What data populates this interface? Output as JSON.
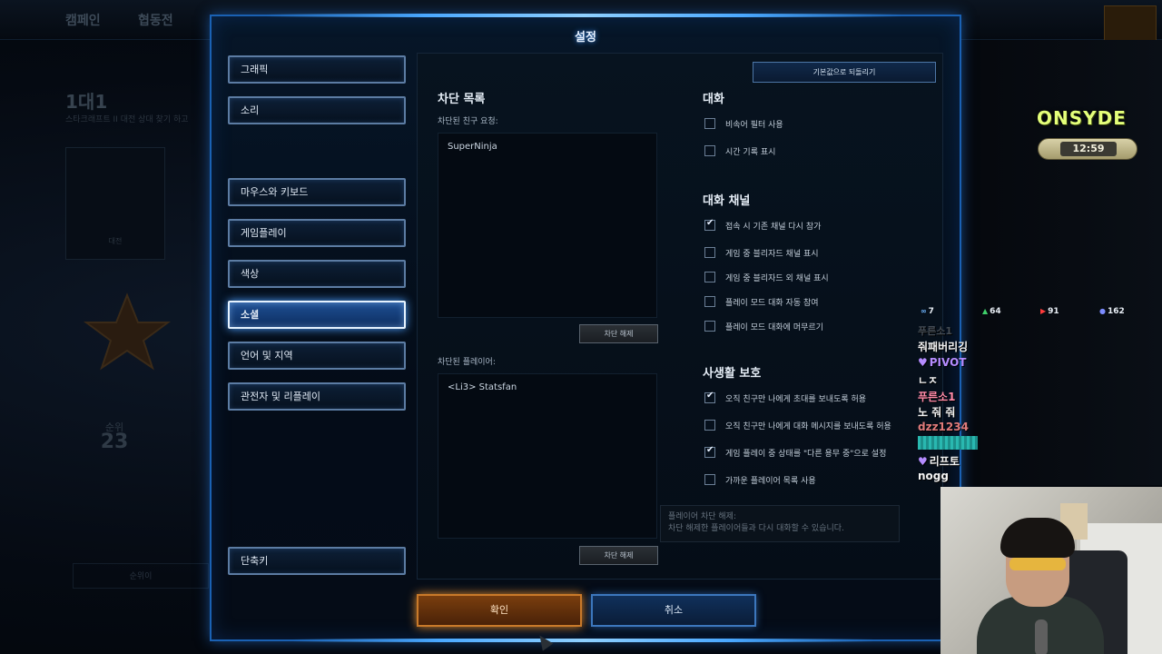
{
  "background": {
    "tabs": [
      "캠페인",
      "협동전"
    ],
    "title": "1대1",
    "subtitle": "스타크래프트 II 대전 상대 찾기 하고",
    "card_label": "대전",
    "rank_label": "순위",
    "rank_number": "23",
    "bottom_bar": "순위이"
  },
  "dialog": {
    "title": "설정",
    "nav": [
      {
        "label": "그래픽"
      },
      {
        "label": "소리"
      },
      {
        "label": "마우스와 키보드"
      },
      {
        "label": "게임플레이"
      },
      {
        "label": "색상"
      },
      {
        "label": "소셜",
        "active": true
      },
      {
        "label": "언어 및 지역"
      },
      {
        "label": "관전자 및 리플레이"
      }
    ],
    "hotkeys": "단축키",
    "reset_label": "기본값으로 되돌리기",
    "blocked": {
      "heading": "차단 목록",
      "requests_label": "차단된 친구 요청:",
      "requests": [
        "SuperNinja"
      ],
      "unblock_label": "차단 해제",
      "players_label": "차단된 플레이어:",
      "players": [
        "<Li3> Statsfan"
      ],
      "block_label": "차단 해제"
    },
    "chat": {
      "heading": "대화",
      "options": [
        {
          "label": "비속어 필터 사용",
          "checked": false
        },
        {
          "label": "시간 기록 표시",
          "checked": false
        }
      ]
    },
    "chat_channel": {
      "heading": "대화 채널",
      "options": [
        {
          "label": "접속 시 기존 채널 다시 참가",
          "checked": true
        },
        {
          "label": "게임 중 블리자드 채널 표시",
          "checked": false
        },
        {
          "label": "게임 중 블리자드 외 채널 표시",
          "checked": false
        },
        {
          "label": "플레이 모드 대화 자동 참여",
          "checked": false
        },
        {
          "label": "플레이 모드 대화에 머무르기",
          "checked": false
        }
      ]
    },
    "privacy": {
      "heading": "사생활 보호",
      "options": [
        {
          "label": "오직 친구만 나에게 초대를 보내도록 허용",
          "checked": true
        },
        {
          "label": "오직 친구만 나에게 대화 메시지를 보내도록 허용",
          "checked": false
        },
        {
          "label": "게임 플레이 중 상태를 \"다른 용무 중\"으로 설정",
          "checked": true
        },
        {
          "label": "가까운 플레이어 목록 사용",
          "checked": false
        }
      ]
    },
    "tooltip": {
      "title": "플레이어 차단 해제:",
      "body": "차단 해제한 플레이어들과 다시 대화할 수 있습니다."
    },
    "ok_label": "확인",
    "cancel_label": "취소"
  },
  "overlay": {
    "brand": "ONSYDE",
    "clock": "12:59",
    "stats": [
      {
        "icon": "∞",
        "value": "7",
        "color": "#6fb6ff"
      },
      {
        "icon": "▲",
        "value": "64",
        "color": "#3fd06a"
      },
      {
        "icon": "▶",
        "value": "91",
        "color": "#ff3b3b"
      },
      {
        "icon": "●",
        "value": "162",
        "color": "#7c8cff"
      }
    ],
    "chat": [
      {
        "text": "푸른소1",
        "color": "#444c55"
      },
      {
        "text": "줘패버리깅",
        "color": "#f2f2f2"
      },
      {
        "text": "PIVOT",
        "color": "#b58cff",
        "heart": true
      },
      {
        "text": "ㄴㅈ",
        "color": "#f2f2f2"
      },
      {
        "text": "푸른소1",
        "color": "#ff8aa8"
      },
      {
        "text": "노 줘 줘",
        "color": "#f2f2f2"
      },
      {
        "text": "dzz1234",
        "color": "#e07b7b"
      },
      {
        "text": "리프토",
        "color": "#f2f2f2",
        "heart": true
      },
      {
        "text": "nogg",
        "color": "#f2f2f2"
      }
    ]
  }
}
